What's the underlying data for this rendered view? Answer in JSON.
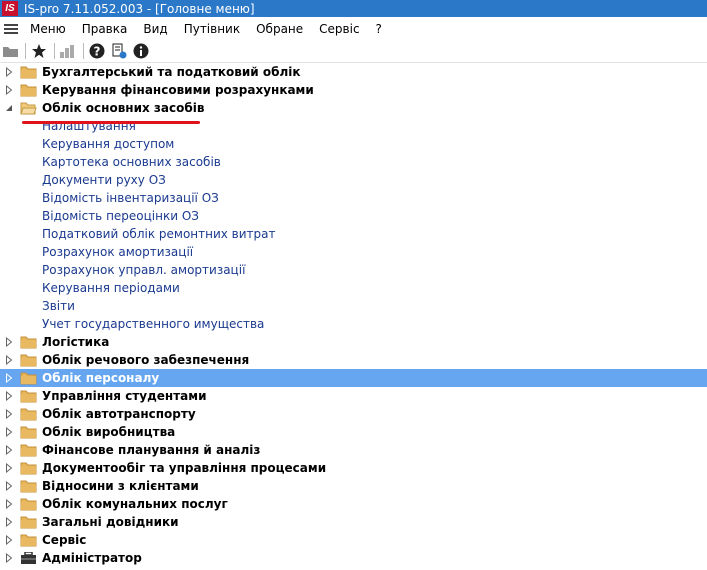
{
  "window": {
    "title": "IS-pro 7.11.052.003 - [Головне меню]",
    "logo_text": "IS"
  },
  "menu": [
    "Меню",
    "Правка",
    "Вид",
    "Путівник",
    "Обране",
    "Сервіс",
    "?"
  ],
  "colors": {
    "titlebar": "#2b78c9",
    "selection": "#66a6f0",
    "folder": "#d9a94c",
    "child_text": "#1a3a8f",
    "annotation": "#e0121b"
  },
  "toolbar": {
    "icons": [
      "folder-icon",
      "favorites-star-icon",
      "chart-icon",
      "help-icon",
      "document-info-icon",
      "info-icon"
    ]
  },
  "tree": [
    {
      "label": "Бухгалтерський та податковий облік",
      "level": 0,
      "state": "collapsed"
    },
    {
      "label": "Керування фінансовими розрахунками",
      "level": 0,
      "state": "collapsed"
    },
    {
      "label": "Облік основних засобів",
      "level": 0,
      "state": "expanded"
    },
    {
      "label": "Налаштування",
      "level": 1
    },
    {
      "label": "Керування доступом",
      "level": 1
    },
    {
      "label": "Картотека основних засобів",
      "level": 1
    },
    {
      "label": "Документи руху ОЗ",
      "level": 1
    },
    {
      "label": "Відомість інвентаризації ОЗ",
      "level": 1
    },
    {
      "label": "Відомість переоцінки ОЗ",
      "level": 1
    },
    {
      "label": "Податковий облік ремонтних витрат",
      "level": 1
    },
    {
      "label": "Розрахунок амортизації",
      "level": 1
    },
    {
      "label": "Розрахунок управл. амортизації",
      "level": 1
    },
    {
      "label": "Керування періодами",
      "level": 1
    },
    {
      "label": "Звіти",
      "level": 1
    },
    {
      "label": "Учет государственного имущества",
      "level": 1
    },
    {
      "label": "Логістика",
      "level": 0,
      "state": "collapsed"
    },
    {
      "label": "Облік речового забезпечення",
      "level": 0,
      "state": "collapsed"
    },
    {
      "label": "Облік персоналу",
      "level": 0,
      "state": "collapsed",
      "selected": true
    },
    {
      "label": "Управління студентами",
      "level": 0,
      "state": "collapsed"
    },
    {
      "label": "Облік автотранспорту",
      "level": 0,
      "state": "collapsed"
    },
    {
      "label": "Облік виробництва",
      "level": 0,
      "state": "collapsed"
    },
    {
      "label": "Фінансове планування й аналіз",
      "level": 0,
      "state": "collapsed"
    },
    {
      "label": "Документообіг та управління процесами",
      "level": 0,
      "state": "collapsed"
    },
    {
      "label": "Відносини з клієнтами",
      "level": 0,
      "state": "collapsed"
    },
    {
      "label": "Облік комунальних послуг",
      "level": 0,
      "state": "collapsed"
    },
    {
      "label": "Загальні довідники",
      "level": 0,
      "state": "collapsed"
    },
    {
      "label": "Сервіс",
      "level": 0,
      "state": "collapsed"
    },
    {
      "label": "Адміністратор",
      "level": 0,
      "state": "collapsed",
      "icon": "toolbox-icon"
    }
  ]
}
